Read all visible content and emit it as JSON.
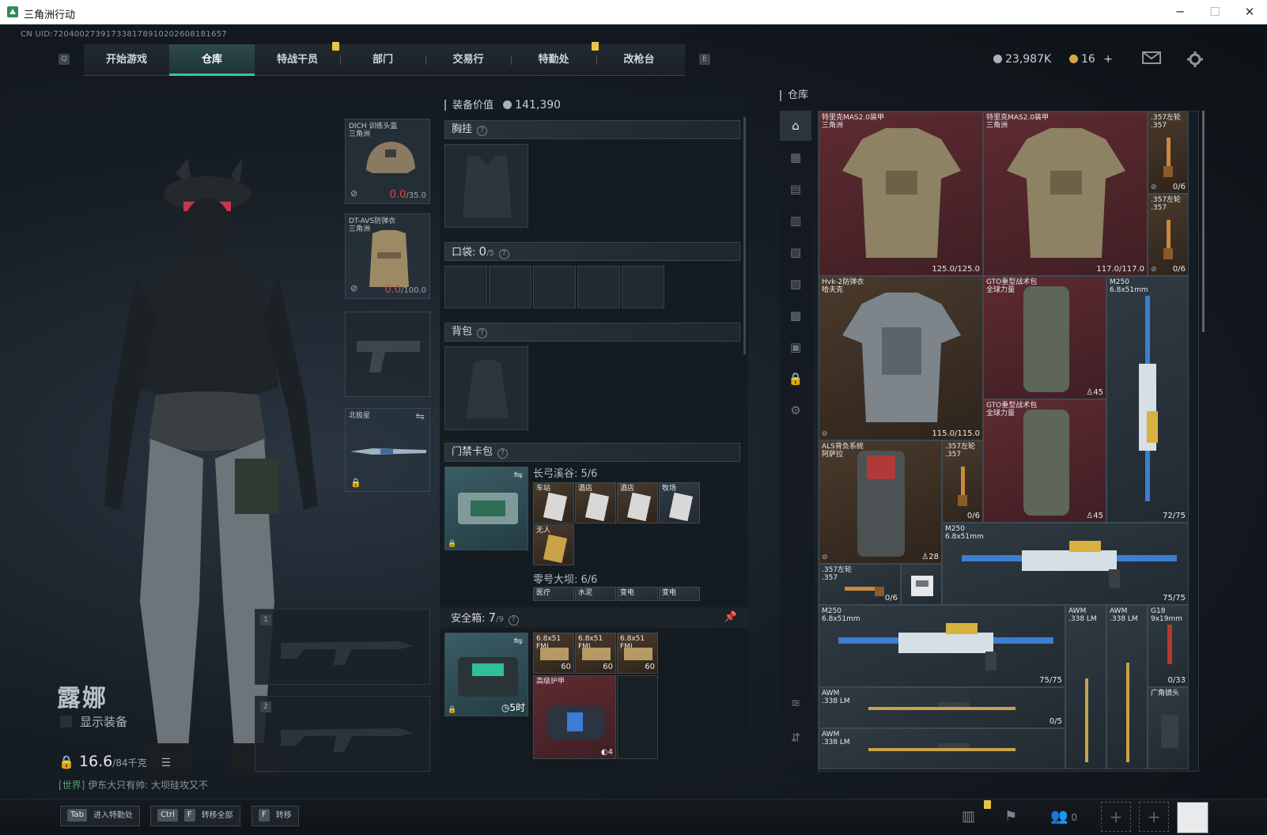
{
  "window": {
    "title": "三角洲行动",
    "minimize": "─",
    "maximize": "☐",
    "close": "✕"
  },
  "uid": "CN UID:720400273917338178910202608181657",
  "nav": {
    "key_left": "Q",
    "key_right": "E",
    "tabs": [
      "开始游戏",
      "仓库",
      "特战干员",
      "部门",
      "交易行",
      "特勤处",
      "改枪台"
    ],
    "active": "仓库"
  },
  "currency": {
    "coins": "23,987K",
    "tokens": "16",
    "plus": "+"
  },
  "character": {
    "name": "露娜",
    "show_gear": "显示装备",
    "weight": "16.6",
    "weight_max": "/84千克"
  },
  "chat": {
    "channel": "[世界]",
    "text": "伊东大只有帅: 大坝硅攻又不"
  },
  "gear_slots": {
    "helmet": {
      "name": "DICH 训练头盔",
      "sub": "三角洲",
      "dur": "0.0",
      "dur_max": "/35.0"
    },
    "armor": {
      "name": "DT-AVS防弹衣",
      "sub": "三角洲",
      "dur": "0.0",
      "dur_max": "/100.0"
    },
    "melee": {
      "name": "北极星"
    },
    "weapon1": "1",
    "weapon2": "2"
  },
  "loadout": {
    "value_label": "装备价值",
    "value": "141,390",
    "chest": "胸挂",
    "pocket": "口袋:",
    "pocket_count": "0",
    "pocket_max": "/5",
    "backpack": "背包",
    "keycard": "门禁卡包",
    "keycard_group1": "长弓溪谷: 5/6",
    "keycard_group1_items": [
      "车站",
      "酒店",
      "酒店",
      "牧场",
      "无人"
    ],
    "keycard_group2": "零号大坝: 6/6",
    "keycard_group2_items": [
      "医疗",
      "水泥",
      "变电",
      "变电"
    ],
    "safebox": "安全箱:",
    "safebox_count": "7",
    "safebox_max": "/9",
    "safebox_timer": "5时",
    "safebox_items": [
      {
        "name": "6.8x51 FMJ",
        "count": "60"
      },
      {
        "name": "6.8x51 FMJ",
        "count": "60"
      },
      {
        "name": "6.8x51 FMJ",
        "count": "60"
      }
    ],
    "armor_item": {
      "name": "高级护甲",
      "count": "4"
    },
    "question": "?"
  },
  "stash": {
    "title": "仓库",
    "items": [
      {
        "name": "特里克MAS2.0装甲",
        "sub": "三角洲",
        "dur": "125.0/125.0"
      },
      {
        "name": "特里克MAS2.0装甲",
        "sub": "三角洲",
        "dur": "117.0/117.0"
      },
      {
        "name": ".357左轮",
        "sub": ".357",
        "count": "0/6"
      },
      {
        "name": ".357左轮",
        "sub": ".357",
        "count": "0/6"
      },
      {
        "name": "Hvk-2防弹衣",
        "sub": "哈夫克",
        "dur": "115.0/115.0"
      },
      {
        "name": "GTO重型战术包",
        "sub": "全球力量",
        "count": "45"
      },
      {
        "name": "M250",
        "sub": "6.8x51mm",
        "count": "72/75"
      },
      {
        "name": "GTO重型战术包",
        "sub": "全球力量",
        "count": "45"
      },
      {
        "name": "ALS背负系统",
        "sub": "阿萨拉",
        "count": "28"
      },
      {
        "name": ".357左轮",
        "sub": ".357",
        "count": "0/6"
      },
      {
        "name": "M250",
        "sub": "6.8x51mm",
        "count": "75/75"
      },
      {
        "name": ".357左轮",
        "sub": ".357",
        "count": "0/6"
      },
      {
        "name": "M250",
        "sub": "6.8x51mm",
        "count": "75/75"
      },
      {
        "name": "AWM",
        "sub": ".338 LM",
        "count": ""
      },
      {
        "name": "AWM",
        "sub": ".338 LM",
        "count": ""
      },
      {
        "name": "G18",
        "sub": "9x19mm",
        "count": "0/33"
      },
      {
        "name": "AWM",
        "sub": ".338 LM",
        "count": "0/5"
      },
      {
        "name": "广角镜头",
        "sub": "",
        "count": ""
      },
      {
        "name": "AWM",
        "sub": ".338 LM",
        "count": ""
      }
    ]
  },
  "bottom": {
    "keys": [
      {
        "key": "Tab",
        "label": "进入特勤处"
      },
      {
        "key": "Ctrl",
        "key2": "F",
        "label": "转移全部"
      },
      {
        "key": "F",
        "label": "转移"
      }
    ],
    "team_count": "0"
  },
  "colors": {
    "accent": "#39c59a",
    "warn": "#e8c547",
    "danger": "#e04545"
  }
}
